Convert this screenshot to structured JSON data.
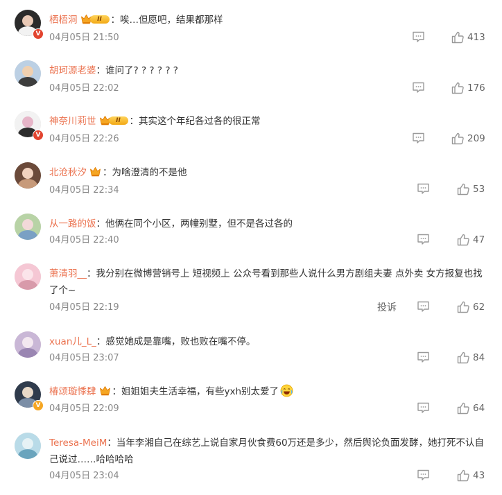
{
  "report_label": "投诉",
  "comments": [
    {
      "user": "栖梧洞",
      "text": "唉…但愿吧，结果都那样",
      "time": "04月05日 21:50",
      "likes": "413",
      "badge": "level2",
      "vbadge": "red"
    },
    {
      "user": "胡珂源老婆",
      "text": "谁问了? ? ? ? ? ?",
      "time": "04月05日 22:02",
      "likes": "176",
      "badge": "none",
      "vbadge": "none"
    },
    {
      "user": "神奈川莉世",
      "text": "其实这个年纪各过各的很正常",
      "time": "04月05日 22:26",
      "likes": "209",
      "badge": "level2",
      "vbadge": "red"
    },
    {
      "user": "北沧秋汐",
      "text": "为啥澄清的不是他",
      "time": "04月05日 22:34",
      "likes": "53",
      "badge": "crown",
      "vbadge": "none"
    },
    {
      "user": "从一路的饭",
      "text": "他俩在同个小区，两幢别墅，但不是各过各的",
      "time": "04月05日 22:40",
      "likes": "47",
      "badge": "none",
      "vbadge": "none"
    },
    {
      "user": "萧清羽__",
      "text": "我分别在微博营销号上 短视频上 公众号看到那些人说什么男方剧组夫妻 点外卖 女方报复也找了个~",
      "time": "04月05日 22:19",
      "likes": "62",
      "badge": "none",
      "vbadge": "none",
      "show_report": true
    },
    {
      "user": "xuan儿_L_",
      "text": "感觉她成是靠嘴，败也败在嘴不停。",
      "time": "04月05日 23:07",
      "likes": "84",
      "badge": "none",
      "vbadge": "none"
    },
    {
      "user": "椿颂璇悸肆",
      "text": "姐姐姐夫生活幸福，有些yxh别太爱了",
      "time": "04月05日 22:09",
      "likes": "64",
      "badge": "crown",
      "vbadge": "gold",
      "emoji": "laugh-cry-emoji"
    },
    {
      "user": "Teresa-MeiM",
      "text": "当年李湘自己在综艺上说自家月伙食费60万还是多少，然后舆论负面发酵，她打死不认自己说过……哈哈哈哈",
      "time": "04月05日 23:04",
      "likes": "43",
      "badge": "none",
      "vbadge": "none"
    }
  ],
  "colors": {
    "username": "#eb7350",
    "meta": "#888888",
    "icon": "#999999"
  },
  "icons": {
    "reply": "comment-reply-icon",
    "like": "thumbs-up-icon",
    "level": "crown-level-badge",
    "verified": "verified-v-badge"
  }
}
